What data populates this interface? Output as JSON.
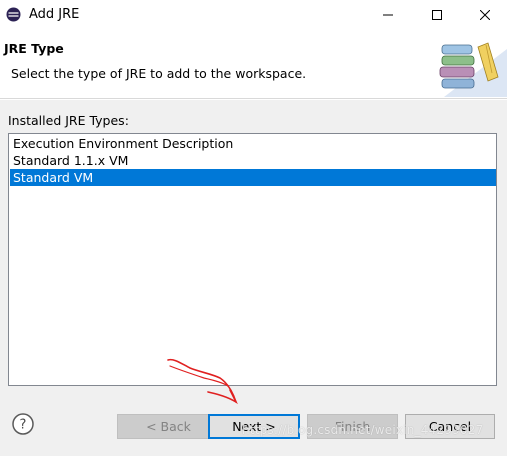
{
  "window": {
    "title": "Add JRE",
    "controls": {
      "minimize_icon": "minimize-icon",
      "maximize_icon": "maximize-icon",
      "close_icon": "close-icon"
    }
  },
  "header": {
    "title": "JRE Type",
    "message": "Select the type of JRE to add to the workspace."
  },
  "list": {
    "label": "Installed JRE Types:",
    "items": [
      {
        "label": "Execution Environment Description",
        "selected": false
      },
      {
        "label": "Standard 1.1.x VM",
        "selected": false
      },
      {
        "label": "Standard VM",
        "selected": true
      }
    ]
  },
  "buttons": {
    "help": "?",
    "back": "< Back",
    "next": "Next >",
    "finish": "Finish",
    "cancel": "Cancel"
  },
  "watermark": "https://blog.csdn.net/weixin_44299027",
  "colors": {
    "selection": "#0078d7",
    "annotation": "#e02020"
  }
}
